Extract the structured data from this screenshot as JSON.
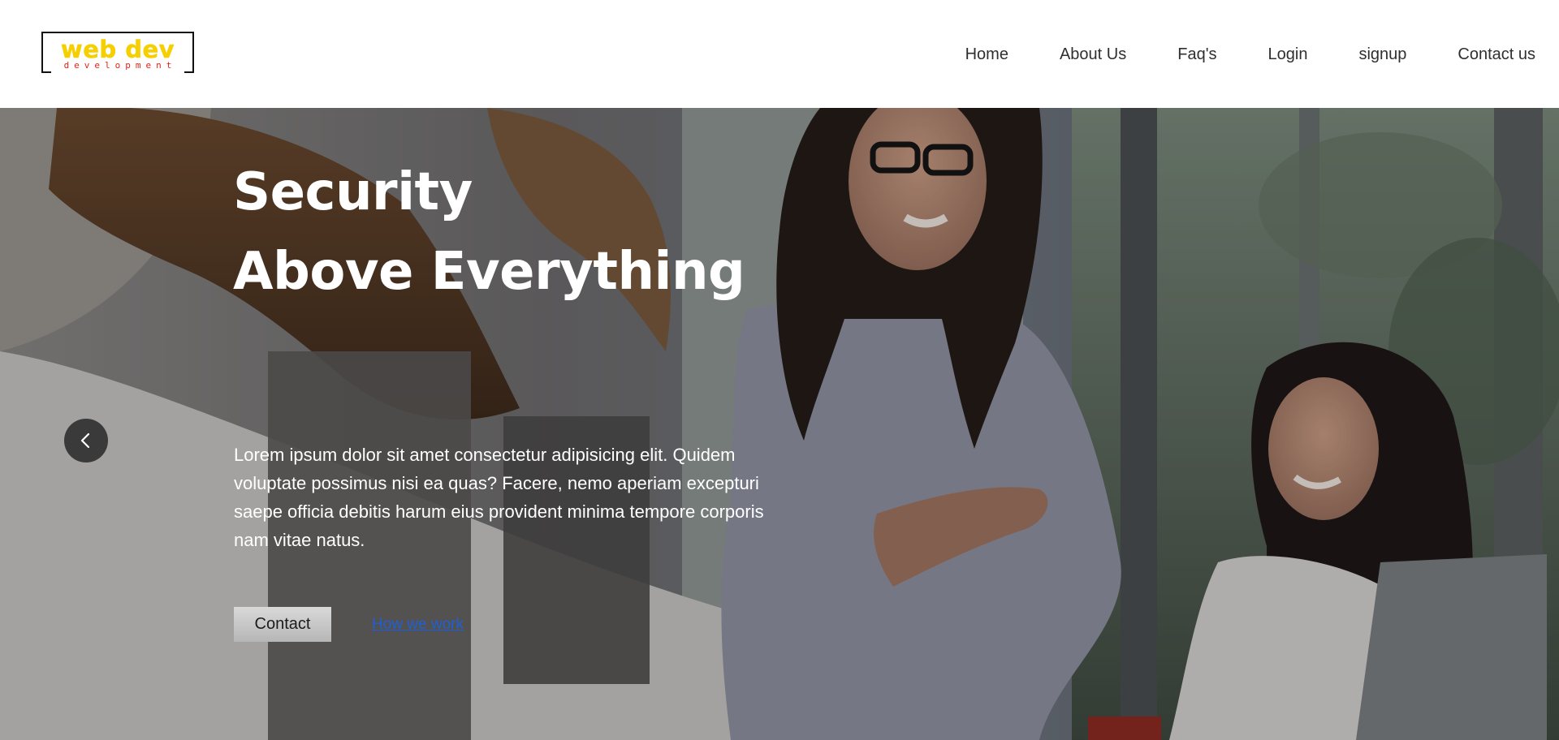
{
  "header": {
    "logo_main": "web dev",
    "logo_sub": "development",
    "logo_main_color": "#f6cf00",
    "logo_sub_color": "#e2231a",
    "nav": [
      {
        "label": "Home"
      },
      {
        "label": "About Us"
      },
      {
        "label": "Faq's"
      },
      {
        "label": "Login"
      },
      {
        "label": "signup"
      },
      {
        "label": "Contact us"
      }
    ]
  },
  "hero": {
    "title_line1": "Security",
    "title_line2": "Above Everything",
    "body": "Lorem ipsum dolor sit amet consectetur adipisicing elit. Quidem voluptate possimus nisi ea quas? Facere, nemo aperiam excepturi saepe officia debitis harum eius provident minima tempore corporis nam vitae natus.",
    "contact_button": "Contact",
    "how_link": "How we work",
    "prev_icon": "chevron-left-icon",
    "link_color": "#1f5fd6"
  }
}
